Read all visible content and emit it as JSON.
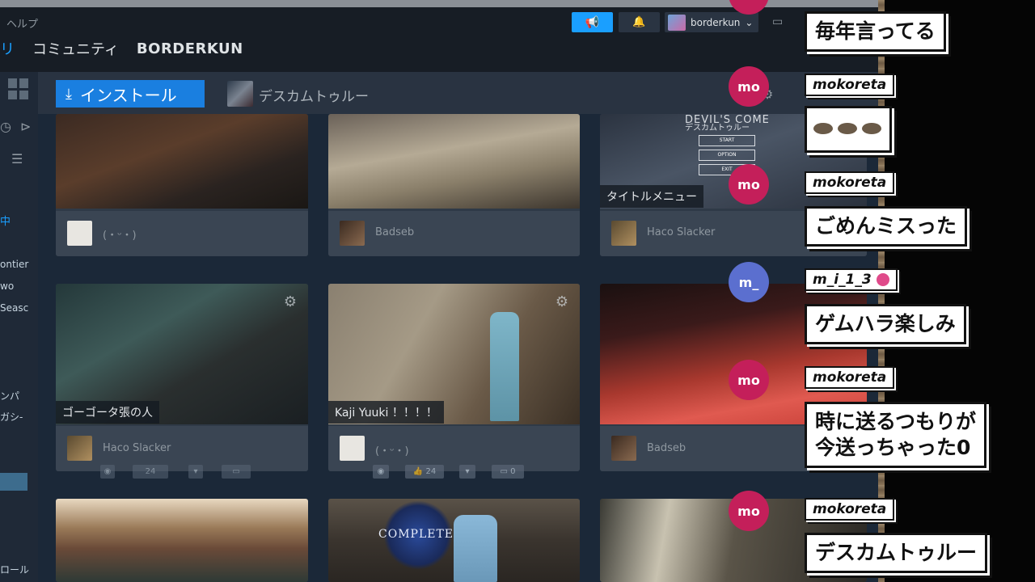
{
  "menu": {
    "help": "ヘルプ"
  },
  "nav": {
    "library": "リ",
    "community": "コミュニティ",
    "user": "BORDERKUN"
  },
  "account": {
    "name": "borderkun",
    "caret": "⌄"
  },
  "sidebar": {
    "in_progress": "中",
    "items": [
      "ontier",
      "wo",
      "Seasc",
      "ンパ",
      "ガシ-",
      "ロール"
    ]
  },
  "game": {
    "install_label": "インストール",
    "title": "デスカムトゥルー"
  },
  "cards": [
    {
      "user": "(・ᵕ・)",
      "caption": ""
    },
    {
      "user": "Badseb",
      "caption": ""
    },
    {
      "user": "Haco Slacker",
      "caption": "タイトルメニュー",
      "menu_title": "DEVIL'S COME",
      "menu_sub": "デスカムトゥルー",
      "menu_buttons": [
        "START",
        "OPTION",
        "EXIT"
      ]
    },
    {
      "user": "Haco Slacker",
      "caption": "ゴーゴータ張の人"
    },
    {
      "user": "(・ᵕ・)",
      "caption": "Kaji Yuuki ！！！！"
    },
    {
      "user": "Badseb",
      "caption": ""
    }
  ],
  "stats": {
    "likes": "24",
    "comments": "0",
    "likes_faint": "24"
  },
  "overlay_text": {
    "complete": "COMPLETE"
  },
  "chat": [
    {
      "initials": "mo",
      "user": "",
      "text": "毎年言ってる"
    },
    {
      "initials": "mo",
      "user": "mokoreta",
      "text": ""
    },
    {
      "initials": "mo",
      "user": "mokoreta",
      "text": "ごめんミスった"
    },
    {
      "initials": "m_",
      "user": "m_i_1_3",
      "text": "ゲムハラ楽しみ"
    },
    {
      "initials": "mo",
      "user": "mokoreta",
      "text": "時に送るつもりが\n今送っちゃった0"
    },
    {
      "initials": "mo",
      "user": "mokoreta",
      "text": "デスカムトゥルー"
    }
  ],
  "colors": {
    "accent": "#1a9fff",
    "mo_bubble": "#c41f5a",
    "m_bubble": "#5b6fcf"
  }
}
